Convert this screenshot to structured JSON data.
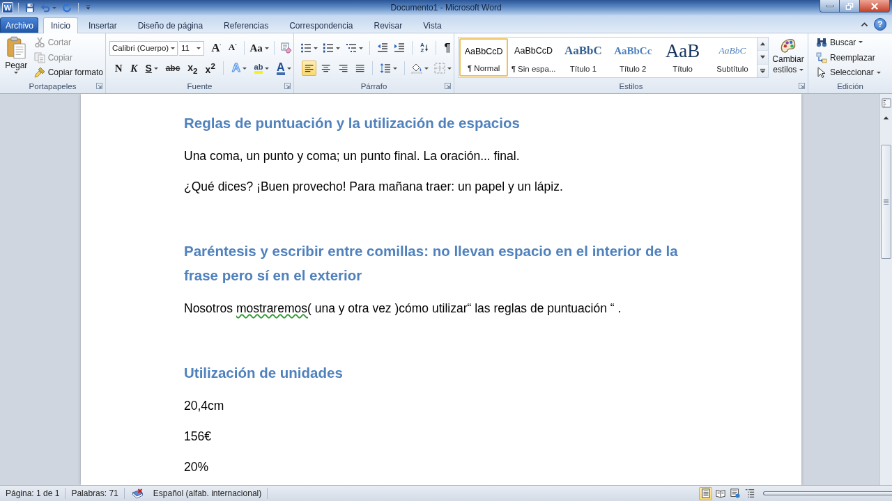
{
  "window": {
    "app_letter": "W",
    "title": "Documento1 - Microsoft Word",
    "help": "?"
  },
  "tabs": [
    {
      "label": "Archivo",
      "kind": "file",
      "selected": false
    },
    {
      "label": "Inicio",
      "kind": "tab",
      "selected": true
    },
    {
      "label": "Insertar",
      "kind": "tab",
      "selected": false
    },
    {
      "label": "Diseño de página",
      "kind": "tab",
      "selected": false
    },
    {
      "label": "Referencias",
      "kind": "tab",
      "selected": false
    },
    {
      "label": "Correspondencia",
      "kind": "tab",
      "selected": false
    },
    {
      "label": "Revisar",
      "kind": "tab",
      "selected": false
    },
    {
      "label": "Vista",
      "kind": "tab",
      "selected": false
    }
  ],
  "clipboard": {
    "label": "Portapapeles",
    "paste": "Pegar",
    "items": [
      {
        "kind": "cut",
        "label": "Cortar",
        "disabled": true
      },
      {
        "kind": "copy",
        "label": "Copiar",
        "disabled": true
      },
      {
        "kind": "format_painter",
        "label": "Copiar formato",
        "disabled": false
      }
    ]
  },
  "font": {
    "label": "Fuente",
    "font_name": "Calibri (Cuerpo)",
    "font_size": "11",
    "grow": "A",
    "shrink": "A",
    "change_case": "Aa",
    "bold": "N",
    "italic": "K",
    "underline": "S",
    "strikethrough": "abc",
    "subscript": "x$_{2}$",
    "superscript": "x$^{2}$",
    "text_effects": "A",
    "highlight": "ab",
    "font_color": "A"
  },
  "paragraph": {
    "label": "Párrafo",
    "sort": [
      "A",
      "Z"
    ],
    "marks": "¶",
    "alignment": [
      {
        "kind": "left",
        "selected": true
      },
      {
        "kind": "center",
        "selected": false
      },
      {
        "kind": "right",
        "selected": false
      },
      {
        "kind": "justify",
        "selected": false
      }
    ]
  },
  "styles": {
    "label": "Estilos",
    "gallery": [
      {
        "kind": "normal",
        "preview": "AaBbCcD",
        "name": "¶ Normal",
        "selected": true
      },
      {
        "kind": "normal",
        "preview": "AaBbCcD",
        "name": "¶ Sin espa...",
        "selected": false
      },
      {
        "kind": "heading1",
        "preview": "AaBbC",
        "name": "Título 1",
        "selected": false
      },
      {
        "kind": "heading2",
        "preview": "AaBbCc",
        "name": "Título 2",
        "selected": false
      },
      {
        "kind": "title",
        "preview": "AaB",
        "name": "Título",
        "selected": false
      },
      {
        "kind": "subtitle",
        "preview": "AaBbC",
        "name": "Subtítulo",
        "selected": false
      }
    ],
    "change_styles": "Cambiar estilos"
  },
  "editing": {
    "label": "Edición",
    "items": [
      {
        "kind": "find",
        "label": "Buscar"
      },
      {
        "kind": "replace",
        "label": "Reemplazar"
      },
      {
        "kind": "select",
        "label": "Seleccionar"
      }
    ]
  },
  "document": {
    "blocks": [
      {
        "kind": "heading",
        "text": "Reglas de puntuación y la utilización de espacios"
      },
      {
        "kind": "paragraph",
        "text": "Una coma, un punto y coma; un punto final. La oración... final."
      },
      {
        "kind": "paragraph",
        "text": "¿Qué dices? ¡Buen provecho! Para mañana traer: un papel y un lápiz."
      },
      {
        "kind": "heading",
        "text": "Paréntesis y escribir entre comillas: no llevan espacio en el interior de la frase pero sí en el exterior"
      },
      {
        "kind": "paragraph",
        "segments": [
          {
            "text": "Nosotros ",
            "grammar_error": false
          },
          {
            "text": "mostraremos(",
            "grammar_error": true
          },
          {
            "text": " una y otra vez )cómo utilizar“ las reglas de puntuación “ .",
            "grammar_error": false
          }
        ]
      },
      {
        "kind": "heading",
        "text": "Utilización de unidades"
      },
      {
        "kind": "paragraph",
        "text": "20,4cm"
      },
      {
        "kind": "paragraph",
        "text": "156€"
      },
      {
        "kind": "paragraph",
        "text": "20%"
      }
    ]
  },
  "status_bar": {
    "page": "Página: 1 de 1",
    "words": "Palabras: 71",
    "language": "Español (alfab. internacional)",
    "views": [
      {
        "kind": "print",
        "selected": true
      },
      {
        "kind": "reading",
        "selected": false
      },
      {
        "kind": "web",
        "selected": false
      },
      {
        "kind": "outline",
        "selected": false
      }
    ]
  }
}
